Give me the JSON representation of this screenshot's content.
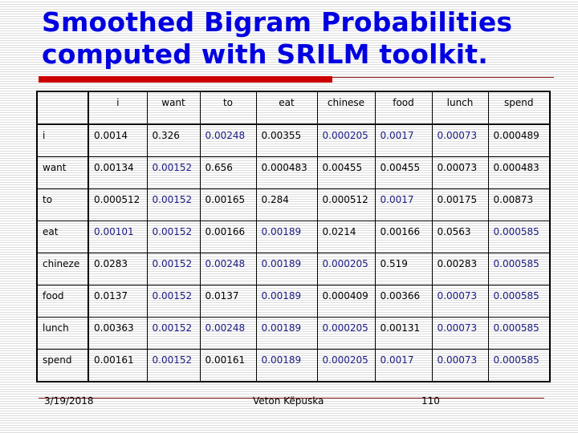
{
  "slide": {
    "title_line1": "Smoothed Bigram Probabilities",
    "title_line2": "computed with SRILM toolkit.",
    "colors": {
      "title": "#0000e0",
      "accent_rule": "#cc0000",
      "highlight_text": "#1a1a80",
      "text": "#000000"
    }
  },
  "table": {
    "columns": [
      "",
      "i",
      "want",
      "to",
      "eat",
      "chinese",
      "food",
      "lunch",
      "spend"
    ],
    "rows": [
      {
        "label": "i",
        "cells": [
          "0.0014",
          "0.326",
          "0.00248",
          "0.00355",
          "0.000205",
          "0.0017",
          "0.00073",
          "0.000489"
        ],
        "highlight": [
          false,
          false,
          true,
          false,
          true,
          true,
          true,
          false
        ]
      },
      {
        "label": "want",
        "cells": [
          "0.00134",
          "0.00152",
          "0.656",
          "0.000483",
          "0.00455",
          "0.00455",
          "0.00073",
          "0.000483"
        ],
        "highlight": [
          false,
          true,
          false,
          false,
          false,
          false,
          false,
          false
        ]
      },
      {
        "label": "to",
        "cells": [
          "0.000512",
          "0.00152",
          "0.00165",
          "0.284",
          "0.000512",
          "0.0017",
          "0.00175",
          "0.00873"
        ],
        "highlight": [
          false,
          true,
          false,
          false,
          false,
          true,
          false,
          false
        ]
      },
      {
        "label": "eat",
        "cells": [
          "0.00101",
          "0.00152",
          "0.00166",
          "0.00189",
          "0.0214",
          "0.00166",
          "0.0563",
          "0.000585"
        ],
        "highlight": [
          true,
          true,
          false,
          true,
          false,
          false,
          false,
          true
        ]
      },
      {
        "label": "chineze",
        "cells": [
          "0.0283",
          "0.00152",
          "0.00248",
          "0.00189",
          "0.000205",
          "0.519",
          "0.00283",
          "0.000585"
        ],
        "highlight": [
          false,
          true,
          true,
          true,
          true,
          false,
          false,
          true
        ]
      },
      {
        "label": "food",
        "cells": [
          "0.0137",
          "0.00152",
          "0.0137",
          "0.00189",
          "0.000409",
          "0.00366",
          "0.00073",
          "0.000585"
        ],
        "highlight": [
          false,
          true,
          false,
          true,
          false,
          false,
          true,
          true
        ]
      },
      {
        "label": "lunch",
        "cells": [
          "0.00363",
          "0.00152",
          "0.00248",
          "0.00189",
          "0.000205",
          "0.00131",
          "0.00073",
          "0.000585"
        ],
        "highlight": [
          false,
          true,
          true,
          true,
          true,
          false,
          true,
          true
        ]
      },
      {
        "label": "spend",
        "cells": [
          "0.00161",
          "0.00152",
          "0.00161",
          "0.00189",
          "0.000205",
          "0.0017",
          "0.00073",
          "0.000585"
        ],
        "highlight": [
          false,
          true,
          false,
          true,
          true,
          true,
          true,
          true
        ]
      }
    ]
  },
  "footer": {
    "date": "3/19/2018",
    "author": "Veton Këpuska",
    "page_number": "110"
  }
}
